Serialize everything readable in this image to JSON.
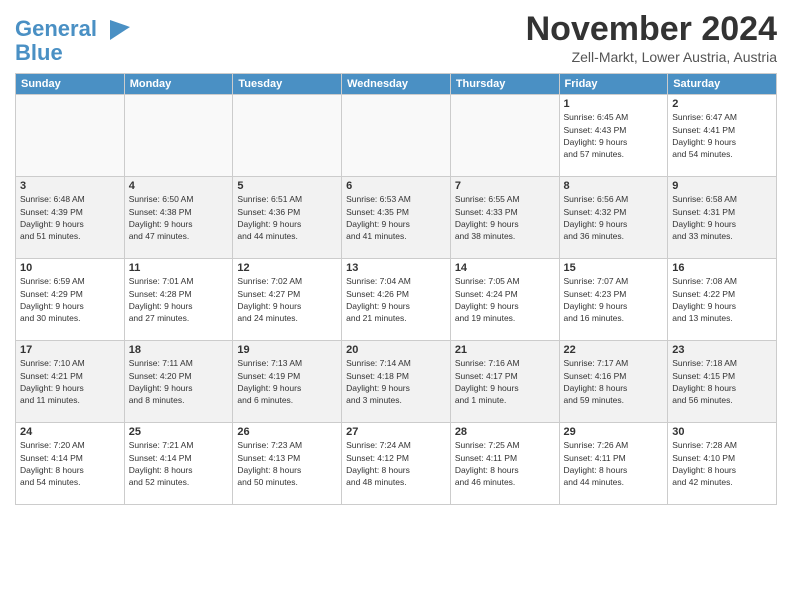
{
  "logo": {
    "line1": "General",
    "line2": "Blue"
  },
  "title": "November 2024",
  "subtitle": "Zell-Markt, Lower Austria, Austria",
  "weekdays": [
    "Sunday",
    "Monday",
    "Tuesday",
    "Wednesday",
    "Thursday",
    "Friday",
    "Saturday"
  ],
  "weeks": [
    [
      {
        "day": "",
        "info": ""
      },
      {
        "day": "",
        "info": ""
      },
      {
        "day": "",
        "info": ""
      },
      {
        "day": "",
        "info": ""
      },
      {
        "day": "",
        "info": ""
      },
      {
        "day": "1",
        "info": "Sunrise: 6:45 AM\nSunset: 4:43 PM\nDaylight: 9 hours\nand 57 minutes."
      },
      {
        "day": "2",
        "info": "Sunrise: 6:47 AM\nSunset: 4:41 PM\nDaylight: 9 hours\nand 54 minutes."
      }
    ],
    [
      {
        "day": "3",
        "info": "Sunrise: 6:48 AM\nSunset: 4:39 PM\nDaylight: 9 hours\nand 51 minutes."
      },
      {
        "day": "4",
        "info": "Sunrise: 6:50 AM\nSunset: 4:38 PM\nDaylight: 9 hours\nand 47 minutes."
      },
      {
        "day": "5",
        "info": "Sunrise: 6:51 AM\nSunset: 4:36 PM\nDaylight: 9 hours\nand 44 minutes."
      },
      {
        "day": "6",
        "info": "Sunrise: 6:53 AM\nSunset: 4:35 PM\nDaylight: 9 hours\nand 41 minutes."
      },
      {
        "day": "7",
        "info": "Sunrise: 6:55 AM\nSunset: 4:33 PM\nDaylight: 9 hours\nand 38 minutes."
      },
      {
        "day": "8",
        "info": "Sunrise: 6:56 AM\nSunset: 4:32 PM\nDaylight: 9 hours\nand 36 minutes."
      },
      {
        "day": "9",
        "info": "Sunrise: 6:58 AM\nSunset: 4:31 PM\nDaylight: 9 hours\nand 33 minutes."
      }
    ],
    [
      {
        "day": "10",
        "info": "Sunrise: 6:59 AM\nSunset: 4:29 PM\nDaylight: 9 hours\nand 30 minutes."
      },
      {
        "day": "11",
        "info": "Sunrise: 7:01 AM\nSunset: 4:28 PM\nDaylight: 9 hours\nand 27 minutes."
      },
      {
        "day": "12",
        "info": "Sunrise: 7:02 AM\nSunset: 4:27 PM\nDaylight: 9 hours\nand 24 minutes."
      },
      {
        "day": "13",
        "info": "Sunrise: 7:04 AM\nSunset: 4:26 PM\nDaylight: 9 hours\nand 21 minutes."
      },
      {
        "day": "14",
        "info": "Sunrise: 7:05 AM\nSunset: 4:24 PM\nDaylight: 9 hours\nand 19 minutes."
      },
      {
        "day": "15",
        "info": "Sunrise: 7:07 AM\nSunset: 4:23 PM\nDaylight: 9 hours\nand 16 minutes."
      },
      {
        "day": "16",
        "info": "Sunrise: 7:08 AM\nSunset: 4:22 PM\nDaylight: 9 hours\nand 13 minutes."
      }
    ],
    [
      {
        "day": "17",
        "info": "Sunrise: 7:10 AM\nSunset: 4:21 PM\nDaylight: 9 hours\nand 11 minutes."
      },
      {
        "day": "18",
        "info": "Sunrise: 7:11 AM\nSunset: 4:20 PM\nDaylight: 9 hours\nand 8 minutes."
      },
      {
        "day": "19",
        "info": "Sunrise: 7:13 AM\nSunset: 4:19 PM\nDaylight: 9 hours\nand 6 minutes."
      },
      {
        "day": "20",
        "info": "Sunrise: 7:14 AM\nSunset: 4:18 PM\nDaylight: 9 hours\nand 3 minutes."
      },
      {
        "day": "21",
        "info": "Sunrise: 7:16 AM\nSunset: 4:17 PM\nDaylight: 9 hours\nand 1 minute."
      },
      {
        "day": "22",
        "info": "Sunrise: 7:17 AM\nSunset: 4:16 PM\nDaylight: 8 hours\nand 59 minutes."
      },
      {
        "day": "23",
        "info": "Sunrise: 7:18 AM\nSunset: 4:15 PM\nDaylight: 8 hours\nand 56 minutes."
      }
    ],
    [
      {
        "day": "24",
        "info": "Sunrise: 7:20 AM\nSunset: 4:14 PM\nDaylight: 8 hours\nand 54 minutes."
      },
      {
        "day": "25",
        "info": "Sunrise: 7:21 AM\nSunset: 4:14 PM\nDaylight: 8 hours\nand 52 minutes."
      },
      {
        "day": "26",
        "info": "Sunrise: 7:23 AM\nSunset: 4:13 PM\nDaylight: 8 hours\nand 50 minutes."
      },
      {
        "day": "27",
        "info": "Sunrise: 7:24 AM\nSunset: 4:12 PM\nDaylight: 8 hours\nand 48 minutes."
      },
      {
        "day": "28",
        "info": "Sunrise: 7:25 AM\nSunset: 4:11 PM\nDaylight: 8 hours\nand 46 minutes."
      },
      {
        "day": "29",
        "info": "Sunrise: 7:26 AM\nSunset: 4:11 PM\nDaylight: 8 hours\nand 44 minutes."
      },
      {
        "day": "30",
        "info": "Sunrise: 7:28 AM\nSunset: 4:10 PM\nDaylight: 8 hours\nand 42 minutes."
      }
    ]
  ]
}
